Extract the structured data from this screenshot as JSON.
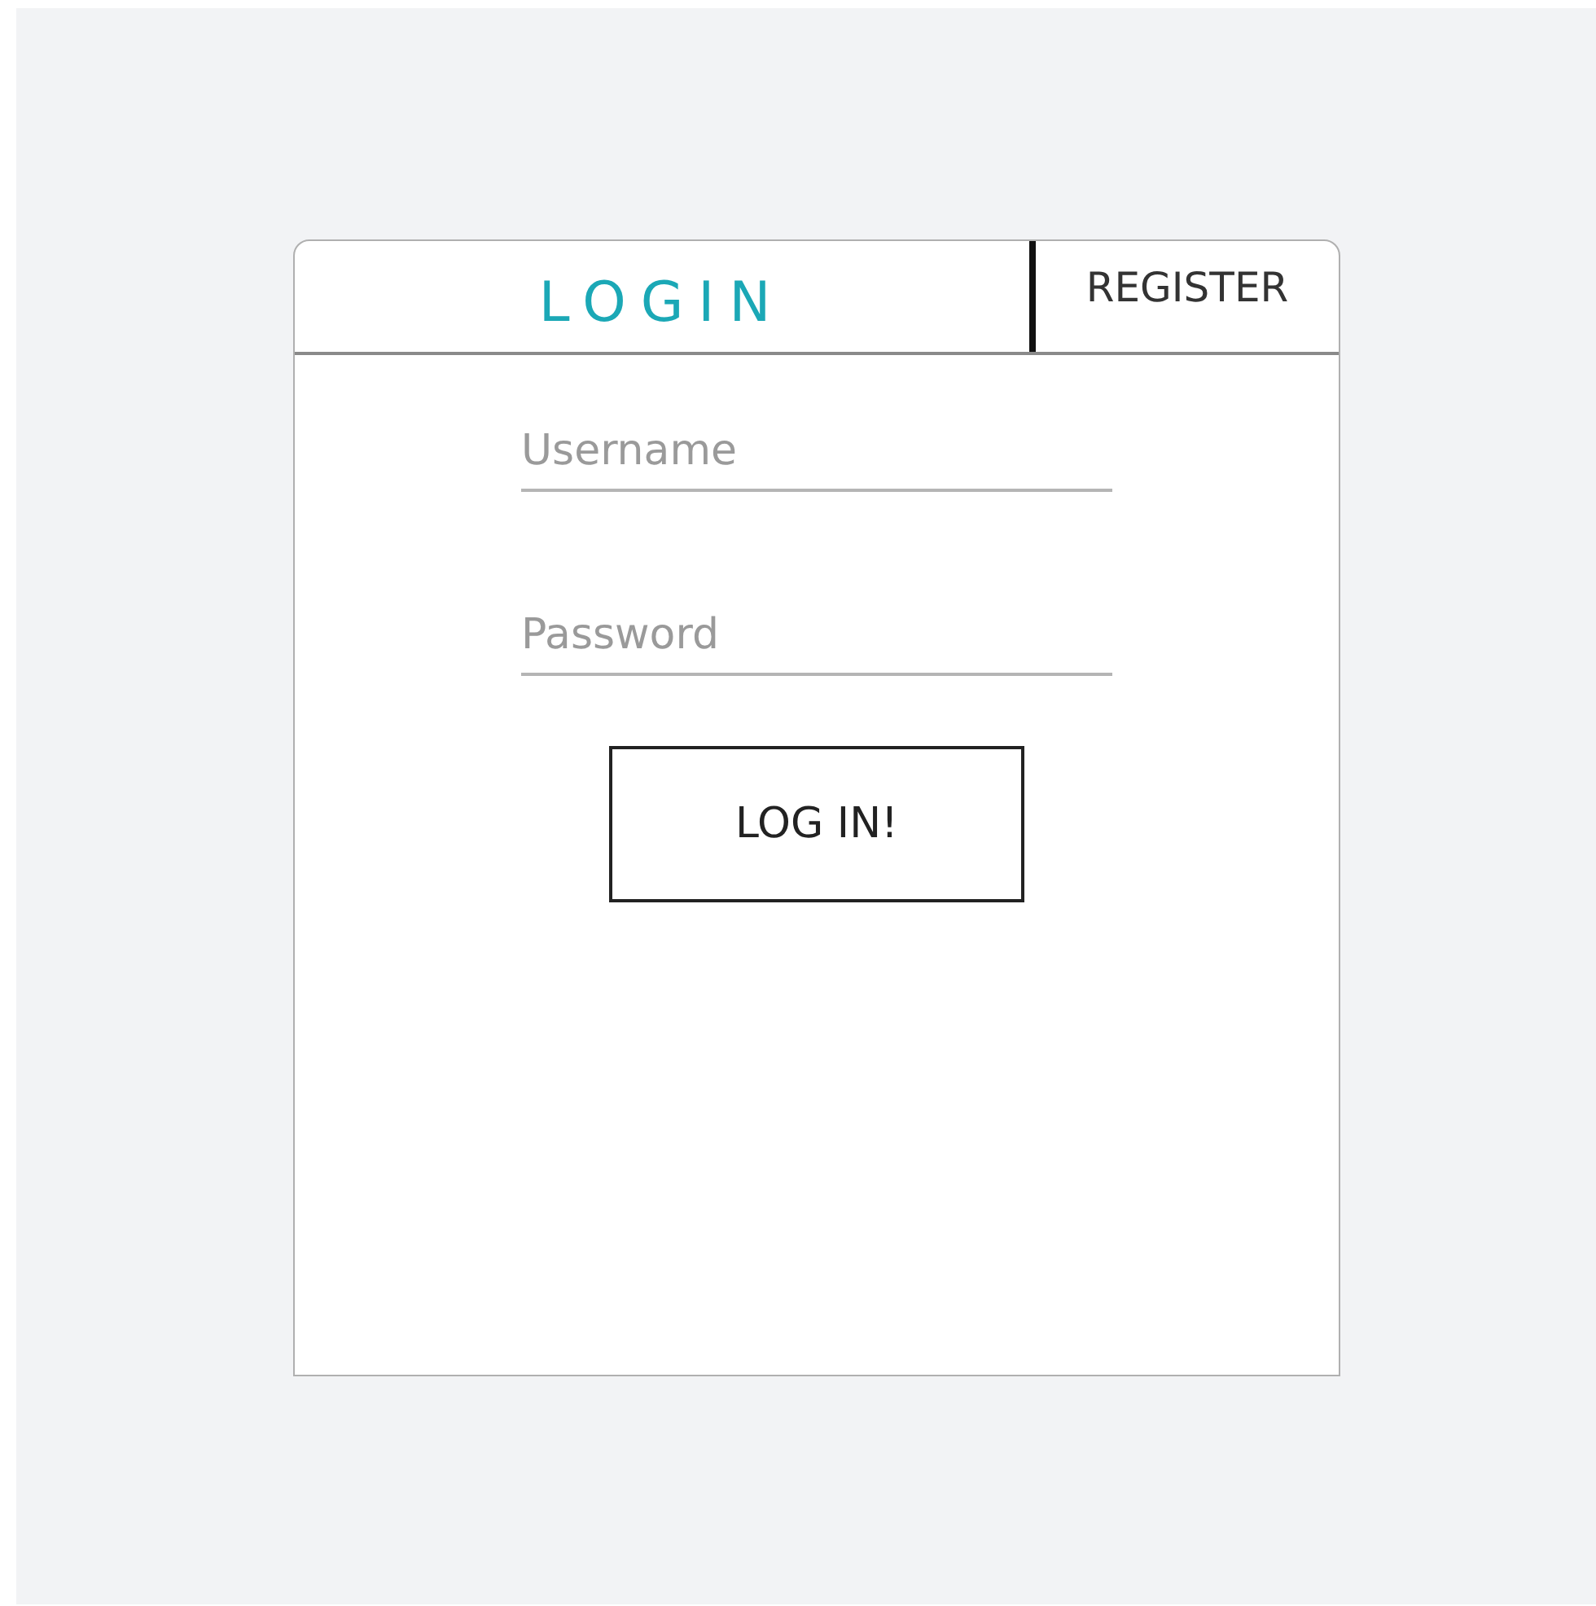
{
  "tabs": [
    {
      "label": "LOGIN",
      "selected": true
    },
    {
      "label": "REGISTER",
      "selected": false
    }
  ],
  "fields": [
    {
      "placeholder": "Username"
    },
    {
      "placeholder": "Password"
    }
  ],
  "submit_button": {
    "label": "LOG IN!"
  }
}
